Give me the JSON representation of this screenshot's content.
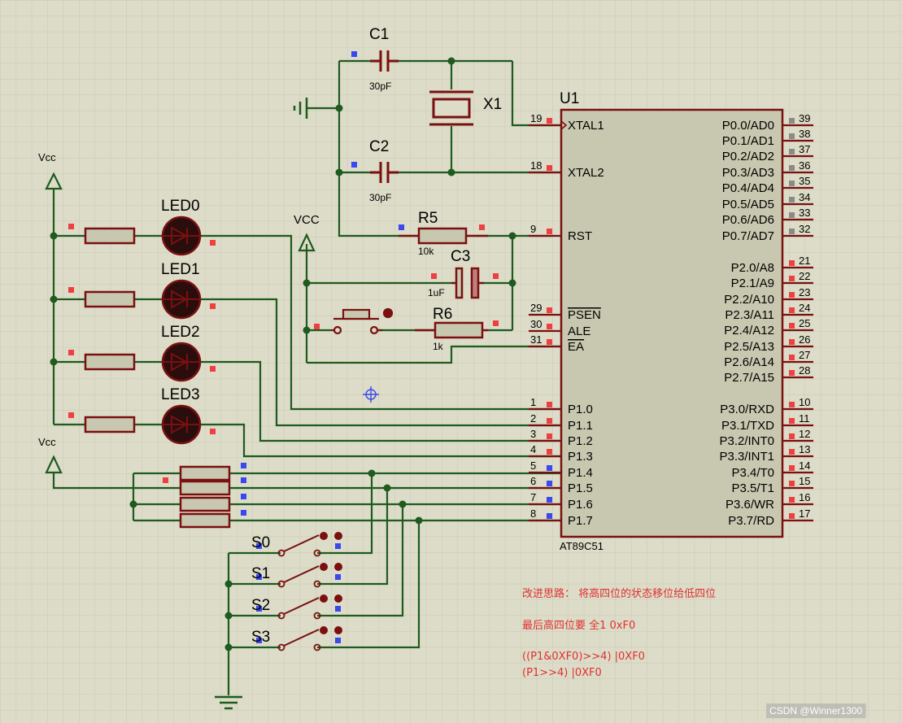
{
  "chip": {
    "ref": "U1",
    "part": "AT89C51",
    "left_pins": [
      {
        "num": "19",
        "name": "XTAL1"
      },
      {
        "num": "18",
        "name": "XTAL2"
      },
      {
        "num": "9",
        "name": "RST"
      },
      {
        "num": "29",
        "name": "PSEN"
      },
      {
        "num": "30",
        "name": "ALE"
      },
      {
        "num": "31",
        "name": "EA"
      },
      {
        "num": "1",
        "name": "P1.0"
      },
      {
        "num": "2",
        "name": "P1.1"
      },
      {
        "num": "3",
        "name": "P1.2"
      },
      {
        "num": "4",
        "name": "P1.3"
      },
      {
        "num": "5",
        "name": "P1.4"
      },
      {
        "num": "6",
        "name": "P1.5"
      },
      {
        "num": "7",
        "name": "P1.6"
      },
      {
        "num": "8",
        "name": "P1.7"
      }
    ],
    "right_pins": [
      {
        "num": "39",
        "name": "P0.0/AD0"
      },
      {
        "num": "38",
        "name": "P0.1/AD1"
      },
      {
        "num": "37",
        "name": "P0.2/AD2"
      },
      {
        "num": "36",
        "name": "P0.3/AD3"
      },
      {
        "num": "35",
        "name": "P0.4/AD4"
      },
      {
        "num": "34",
        "name": "P0.5/AD5"
      },
      {
        "num": "33",
        "name": "P0.6/AD6"
      },
      {
        "num": "32",
        "name": "P0.7/AD7"
      },
      {
        "num": "21",
        "name": "P2.0/A8"
      },
      {
        "num": "22",
        "name": "P2.1/A9"
      },
      {
        "num": "23",
        "name": "P2.2/A10"
      },
      {
        "num": "24",
        "name": "P2.3/A11"
      },
      {
        "num": "25",
        "name": "P2.4/A12"
      },
      {
        "num": "26",
        "name": "P2.5/A13"
      },
      {
        "num": "27",
        "name": "P2.6/A14"
      },
      {
        "num": "28",
        "name": "P2.7/A15"
      },
      {
        "num": "10",
        "name": "P3.0/RXD"
      },
      {
        "num": "11",
        "name": "P3.1/TXD"
      },
      {
        "num": "12",
        "name": "P3.2/INT0"
      },
      {
        "num": "13",
        "name": "P3.3/INT1"
      },
      {
        "num": "14",
        "name": "P3.4/T0"
      },
      {
        "num": "15",
        "name": "P3.5/T1"
      },
      {
        "num": "16",
        "name": "P3.6/WR"
      },
      {
        "num": "17",
        "name": "P3.7/RD"
      }
    ]
  },
  "components": {
    "c1": {
      "ref": "C1",
      "value": "30pF"
    },
    "c2": {
      "ref": "C2",
      "value": "30pF"
    },
    "c3": {
      "ref": "C3",
      "value": "1uF"
    },
    "x1": {
      "ref": "X1"
    },
    "r5": {
      "ref": "R5",
      "value": "10k"
    },
    "r6": {
      "ref": "R6",
      "value": "1k"
    },
    "leds": [
      "LED0",
      "LED1",
      "LED2",
      "LED3"
    ],
    "switches": [
      "S0",
      "S1",
      "S2",
      "S3"
    ]
  },
  "power": {
    "vcc_left_top": "Vcc",
    "vcc_left_bottom": "Vcc",
    "vcc_mid": "VCC"
  },
  "notes": [
    "改进思路： 将高四位的状态移位给低四位",
    "最后高四位要 全1  0xF0",
    "((P1&0XF0)>>4)  |0XF0",
    "(P1>>4) |0XF0"
  ],
  "watermark": "CSDN @Winner1300",
  "colors": {
    "background": "#dcdcc8",
    "grid": "#c9c9b4",
    "wire": "#1f5a1f",
    "component": "#7a1010",
    "chip_fill": "#c8c8b0",
    "pin_red": "#ee4040",
    "pin_blue": "#3a48ee",
    "note": "#e03030"
  }
}
